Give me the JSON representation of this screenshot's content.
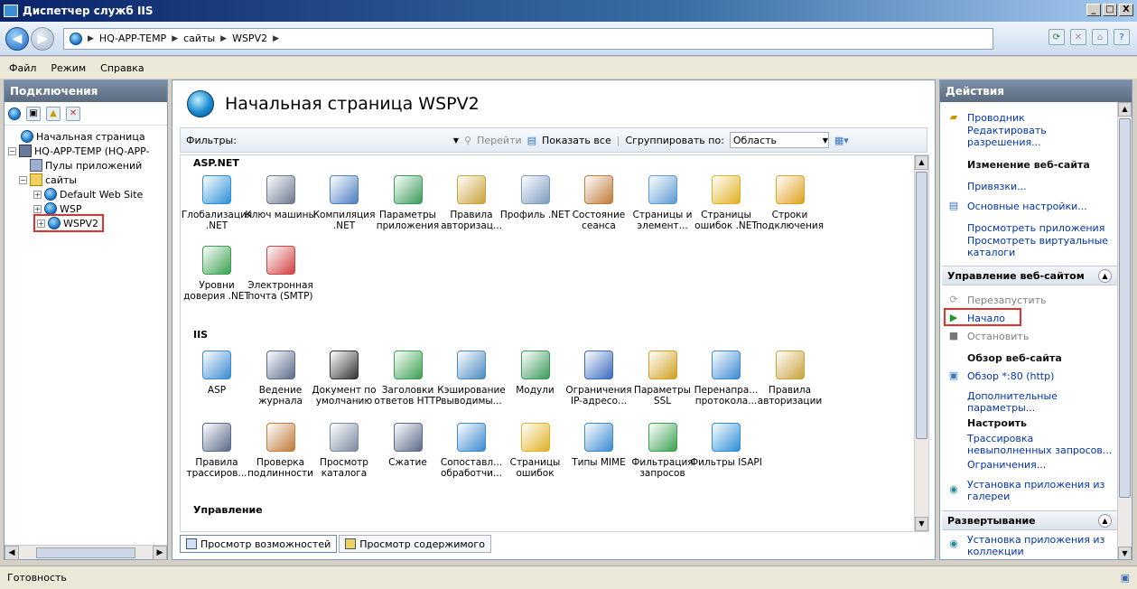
{
  "window": {
    "title": "Диспетчер служб IIS",
    "buttons": [
      "_",
      "□",
      "X"
    ]
  },
  "address": {
    "crumbs": [
      "HQ-APP-TEMP",
      "сайты",
      "WSPV2"
    ]
  },
  "menu": [
    {
      "label": "Файл"
    },
    {
      "label": "Режим"
    },
    {
      "label": "Справка"
    }
  ],
  "connections": {
    "title": "Подключения",
    "tree": [
      {
        "label": "Начальная страница",
        "indent": 0
      },
      {
        "label": "HQ-APP-TEMP (HQ-APP-",
        "indent": 0,
        "toggle": "−"
      },
      {
        "label": "Пулы приложений",
        "indent": 1
      },
      {
        "label": "сайты",
        "indent": 1,
        "toggle": "−"
      },
      {
        "label": "Default Web Site",
        "indent": 2,
        "toggle": "+"
      },
      {
        "label": "WSP",
        "indent": 2,
        "toggle": "+"
      },
      {
        "label": "WSPV2",
        "indent": 2,
        "toggle": "+",
        "selected": true
      }
    ]
  },
  "center": {
    "title": "Начальная страница WSPV2",
    "filters_label": "Фильтры:",
    "go_label": "Перейти",
    "show_all_label": "Показать все",
    "group_by_label": "Сгруппировать по:",
    "group_by_value": "Область",
    "sections": [
      {
        "name": "ASP.NET",
        "items": [
          {
            "label": "Глобализация .NET",
            "icon": "globe",
            "color": "#2a8fd6"
          },
          {
            "label": "Ключ машины",
            "icon": "key",
            "color": "#6b7a90"
          },
          {
            "label": "Компиляция .NET",
            "icon": "compile",
            "color": "#4a7fc0"
          },
          {
            "label": "Параметры приложения",
            "icon": "settings",
            "color": "#3a9a5a"
          },
          {
            "label": "Правила авторизац...",
            "icon": "lock-doc",
            "color": "#c9a23a"
          },
          {
            "label": "Профиль .NET",
            "icon": "profile",
            "color": "#7a9ac0"
          },
          {
            "label": "Состояние сеанса",
            "icon": "session",
            "color": "#c07a3a"
          },
          {
            "label": "Страницы и элемент...",
            "icon": "pages",
            "color": "#5a9ad0"
          },
          {
            "label": "Страницы ошибок .NET",
            "icon": "error-page",
            "color": "#e0b020"
          },
          {
            "label": "Строки подключения",
            "icon": "db",
            "color": "#e0a020"
          },
          {
            "label": "Уровни доверия .NET",
            "icon": "trust",
            "color": "#3aa050"
          },
          {
            "label": "Электронная почта (SMTP)",
            "icon": "mail",
            "color": "#d04040"
          }
        ]
      },
      {
        "name": "IIS",
        "items": [
          {
            "label": "ASP",
            "icon": "asp",
            "color": "#3a8ad0"
          },
          {
            "label": "Ведение журнала",
            "icon": "log",
            "color": "#5a6a8a"
          },
          {
            "label": "Документ по умолчанию",
            "icon": "default-doc",
            "color": "#333333"
          },
          {
            "label": "Заголовки ответов HTTP",
            "icon": "headers",
            "color": "#3aa050"
          },
          {
            "label": "Кэширование выводимы...",
            "icon": "cache",
            "color": "#4a8ac0"
          },
          {
            "label": "Модули",
            "icon": "modules",
            "color": "#3a9a5a"
          },
          {
            "label": "Ограничения IP-адресо...",
            "icon": "ip",
            "color": "#3a6ac0"
          },
          {
            "label": "Параметры SSL",
            "icon": "ssl",
            "color": "#d0a020"
          },
          {
            "label": "Перенапра... протокола...",
            "icon": "redirect",
            "color": "#3a8ad0"
          },
          {
            "label": "Правила авторизации",
            "icon": "auth-rules",
            "color": "#c9a23a"
          },
          {
            "label": "Правила трассиров...",
            "icon": "trace",
            "color": "#5a6a8a"
          },
          {
            "label": "Проверка подлинности",
            "icon": "auth",
            "color": "#c07a3a"
          },
          {
            "label": "Просмотр каталога",
            "icon": "dir",
            "color": "#7a8aa0"
          },
          {
            "label": "Сжатие",
            "icon": "compress",
            "color": "#5a6a8a"
          },
          {
            "label": "Сопоставл... обработчи...",
            "icon": "handler",
            "color": "#3a8ad0"
          },
          {
            "label": "Страницы ошибок",
            "icon": "error-page",
            "color": "#e0b020"
          },
          {
            "label": "Типы MIME",
            "icon": "mime",
            "color": "#3a8ad0"
          },
          {
            "label": "Фильтрация запросов",
            "icon": "filter",
            "color": "#3aa050"
          },
          {
            "label": "Фильтры ISAPI",
            "icon": "isapi",
            "color": "#2a8fd6"
          }
        ]
      },
      {
        "name": "Управление",
        "items": []
      }
    ],
    "tabs": [
      {
        "label": "Просмотр возможностей",
        "active": true
      },
      {
        "label": "Просмотр содержимого",
        "active": false
      }
    ]
  },
  "actions": {
    "title": "Действия",
    "explore": "Проводник",
    "edit_perms": "Редактировать разрешения...",
    "edit_site_head": "Изменение веб-сайта",
    "bindings": "Привязки...",
    "basic_settings": "Основные настройки...",
    "view_apps": "Просмотреть приложения",
    "view_vdirs": "Просмотреть виртуальные каталоги",
    "manage_head": "Управление веб-сайтом",
    "restart": "Перезапустить",
    "start": "Начало",
    "stop": "Остановить",
    "browse_head": "Обзор веб-сайта",
    "browse_80": "Обзор *:80 (http)",
    "advanced": "Дополнительные параметры...",
    "configure_head": "Настроить",
    "failed_trace": "Трассировка невыполненных запросов...",
    "limits": "Ограничения...",
    "install_gallery": "Установка приложения из галереи",
    "deploy_head": "Развертывание",
    "install_collection": "Установка приложения из коллекции"
  },
  "status": {
    "text": "Готовность"
  }
}
